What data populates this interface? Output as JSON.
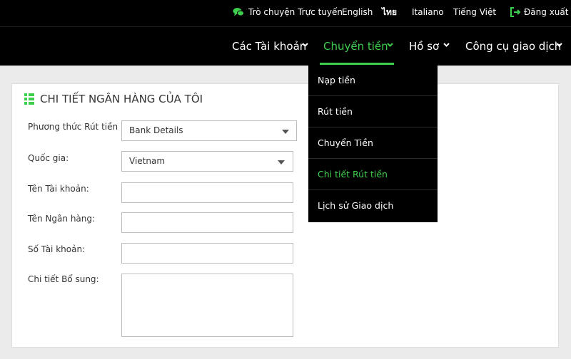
{
  "topbar": {
    "chat_label": "Trò chuyện Trực tuyến",
    "languages": [
      "English",
      "ไทย",
      "Italiano",
      "Tiếng Việt"
    ],
    "logout_label": "Đăng xuất"
  },
  "nav": {
    "items": [
      {
        "label": "Các Tài khoản"
      },
      {
        "label": "Chuyển tiền"
      },
      {
        "label": "Hồ sơ"
      },
      {
        "label": "Công cụ giao dịch"
      }
    ]
  },
  "dropdown": {
    "items": [
      {
        "label": "Nạp tiền"
      },
      {
        "label": "Rút tiền"
      },
      {
        "label": "Chuyển Tiền"
      },
      {
        "label": "Chi tiết Rút tiền"
      },
      {
        "label": "Lịch sử Giao dịch"
      }
    ]
  },
  "card": {
    "title": "CHI TIẾT NGÂN HÀNG CỦA TÔI",
    "withdraw_method_label": "Phương thức Rút tiền :",
    "withdraw_method_value": "Bank Details",
    "country_label": "Quốc gia:",
    "country_value": "Vietnam",
    "account_name_label": "Tên Tài khoản:",
    "bank_name_label": "Tên Ngân hàng:",
    "account_number_label": "Số Tài khoản:",
    "additional_details_label": "Chi tiết Bổ sung:"
  },
  "colors": {
    "accent": "#3fcf4e",
    "nav_bg": "#000000",
    "page_bg": "#ebebeb"
  }
}
